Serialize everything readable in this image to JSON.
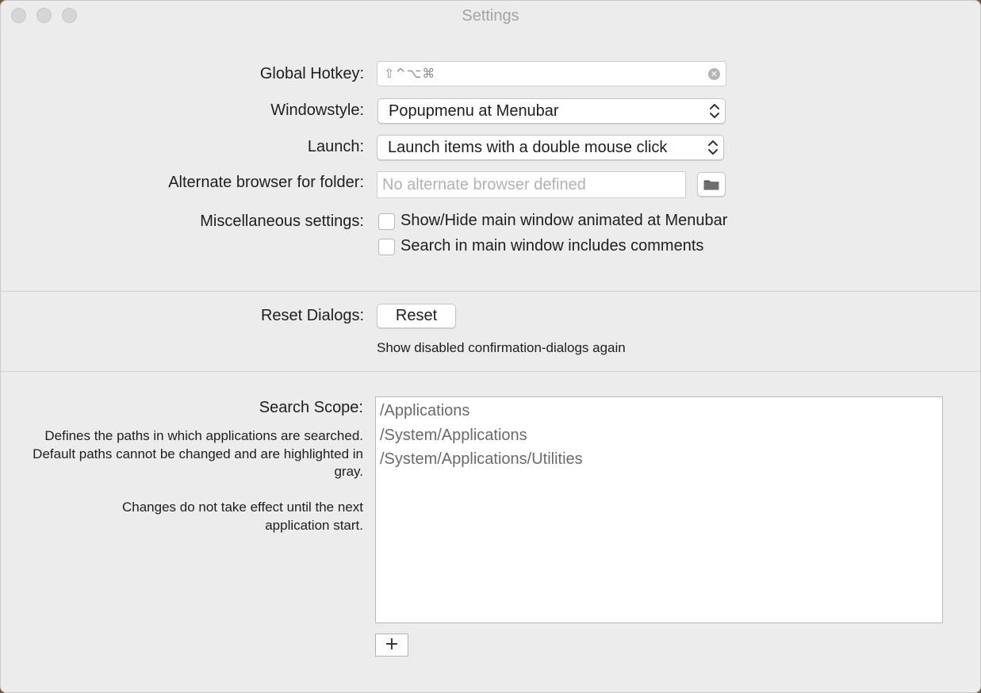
{
  "window": {
    "title": "Settings"
  },
  "general": {
    "hotkey_label": "Global Hotkey:",
    "hotkey_value": "⇧^⌥⌘",
    "windowstyle_label": "Windowstyle:",
    "windowstyle_value": "Popupmenu at Menubar",
    "launch_label": "Launch:",
    "launch_value": "Launch items with a double mouse click",
    "alt_browser_label": "Alternate browser for folder:",
    "alt_browser_placeholder": "No alternate browser defined",
    "alt_browser_value": "",
    "misc_label": "Miscellaneous settings:",
    "misc_options": [
      {
        "label": "Show/Hide main window animated at Menubar",
        "checked": false
      },
      {
        "label": "Search in main window includes comments",
        "checked": false
      }
    ]
  },
  "reset": {
    "label": "Reset Dialogs:",
    "button_label": "Reset",
    "hint": "Show disabled confirmation-dialogs again"
  },
  "search_scope": {
    "label": "Search Scope:",
    "description": "Defines the paths in which applications are searched. Default paths cannot be changed and are highlighted in gray.",
    "note": "Changes do not take effect until the next application start.",
    "paths": [
      "/Applications",
      "/System/Applications",
      "/System/Applications/Utilities"
    ],
    "add_button_label": "+"
  },
  "icons": {
    "hotkey_clear": "clear-icon",
    "popup_chevron": "chevron-updown-icon",
    "folder": "folder-icon"
  }
}
